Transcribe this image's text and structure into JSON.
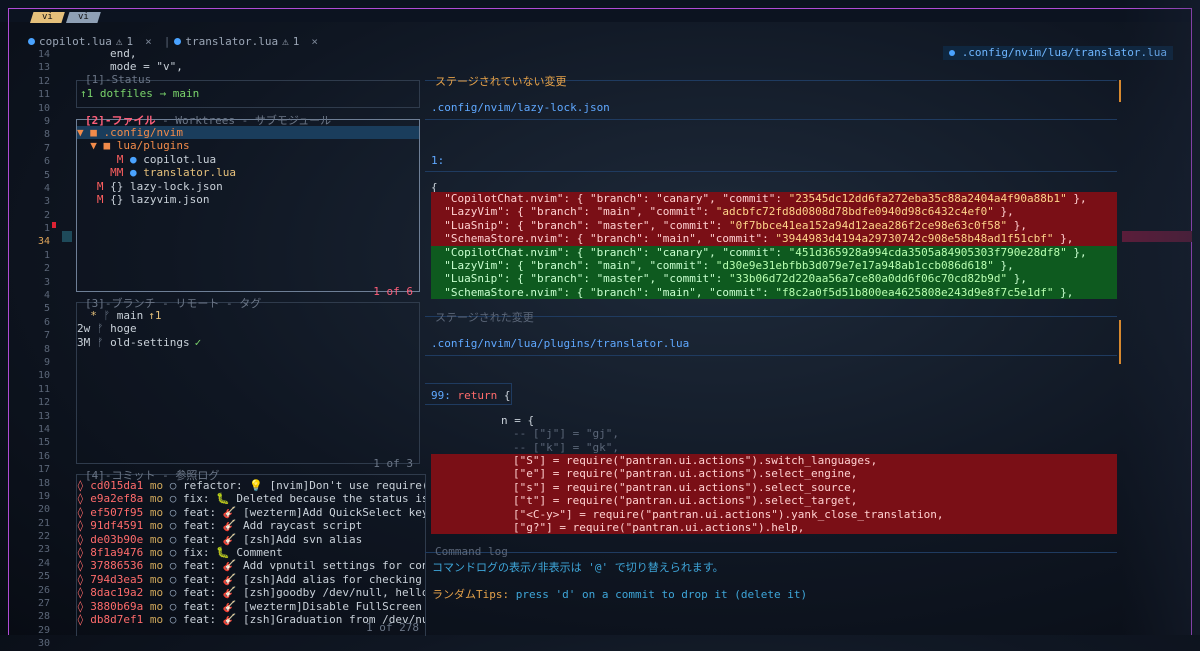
{
  "colors": {
    "accent": "#b04bd6",
    "active_title": "#ff5f7a",
    "path": "#5fa8ff",
    "orange": "#e5a24a",
    "deleted_bg": "#7a0f16",
    "added_bg": "#0e5a1f"
  },
  "mode_tabs": [
    "vi",
    "vi"
  ],
  "buffers": [
    {
      "name": "copilot.lua",
      "warn": "1",
      "close": "×"
    },
    {
      "name": "translator.lua",
      "warn": "1",
      "close": "×"
    }
  ],
  "path_badge": ".config/nvim/lua/translator.lua",
  "gutter": [
    "14",
    "13",
    "12",
    "11",
    "10",
    "9",
    "8",
    "7",
    "6",
    "5",
    "4",
    "3",
    "2",
    "1",
    "34",
    "1",
    "2",
    "3",
    "4",
    "5",
    "6",
    "7",
    "8",
    "9",
    "10",
    "11",
    "12",
    "13",
    "14",
    "15",
    "16",
    "17",
    "18",
    "19",
    "20",
    "21",
    "22",
    "23",
    "24",
    "25",
    "26",
    "27",
    "28",
    "29",
    "30"
  ],
  "code_top": [
    "end,",
    "mode = \"v\","
  ],
  "status": {
    "title": "[1]-Status",
    "text": "↑1 dotfiles → main"
  },
  "files": {
    "title_active": "[2]-ファイル",
    "title_rest": " - Worktrees - サブモジュール",
    "footer": "1 of 6",
    "items": [
      {
        "prefix": "▼ ",
        "name": ".config/nvim",
        "kind": "folder"
      },
      {
        "prefix": "  ▼ ",
        "name": "lua/plugins",
        "kind": "folder"
      },
      {
        "prefix": "      M ",
        "name": "copilot.lua",
        "kind": "lua"
      },
      {
        "prefix": "     MM ",
        "name": "translator.lua",
        "kind": "lua"
      },
      {
        "prefix": "   M ",
        "name": "lazy-lock.json",
        "kind": "json"
      },
      {
        "prefix": "   M ",
        "name": "lazyvim.json",
        "kind": "json"
      }
    ]
  },
  "branches": {
    "title": "[3]-ブランチ - リモート - タグ",
    "footer": "1 of 3",
    "items": [
      {
        "left": "  * ",
        "name": "main",
        "tag": "↑1"
      },
      {
        "left": "2w ",
        "name": "hoge",
        "tag": ""
      },
      {
        "left": "3M ",
        "name": "old-settings",
        "tag": "✓"
      }
    ]
  },
  "commits": {
    "title": "[4]-コミット - 参照ログ",
    "footer": "1 of 278",
    "items": [
      {
        "hash": "cd015da1",
        "author": "mo",
        "msg": "refactor: 💡 [nvim]Don't use require(\"foo"
      },
      {
        "hash": "e9a2ef8a",
        "author": "mo",
        "msg": "fix: 🐛 Deleted because the status is not"
      },
      {
        "hash": "ef507f95",
        "author": "mo",
        "msg": "feat: 🎸 [wezterm]Add QuickSelect keybind"
      },
      {
        "hash": "91df4591",
        "author": "mo",
        "msg": "feat: 🎸 Add raycast script"
      },
      {
        "hash": "de03b90e",
        "author": "mo",
        "msg": "feat: 🎸 [zsh]Add svn alias"
      },
      {
        "hash": "8f1a9476",
        "author": "mo",
        "msg": "fix: 🐛 Comment"
      },
      {
        "hash": "37886536",
        "author": "mo",
        "msg": "feat: 🎸 Add vpnutil settings for connect"
      },
      {
        "hash": "794d3ea5",
        "author": "mo",
        "msg": "feat: 🎸 [zsh]Add alias for checking my i"
      },
      {
        "hash": "8dac19a2",
        "author": "mo",
        "msg": "feat: 🎸 [zsh]goodby /dev/null, hello -qq"
      },
      {
        "hash": "3880b69a",
        "author": "mo",
        "msg": "feat: 🎸 [wezterm]Disable FullScreen comm"
      },
      {
        "hash": "db8d7ef1",
        "author": "mo",
        "msg": "feat: 🎸 [zsh]Graduation from /dev/null"
      }
    ]
  },
  "unstaged": {
    "title": "ステージされていない変更",
    "file": ".config/nvim/lazy-lock.json",
    "hunk": "1:",
    "brace": "{",
    "deleted": [
      {
        "k": "  \"CopilotChat.nvim\": { \"branch\": \"canary\", \"commit\": ",
        "v": "\"23545dc12dd6fa272eba35c88a2404a4f90a88b1\"",
        "t": " },"
      },
      {
        "k": "  \"LazyVim\": { \"branch\": \"main\", \"commit\": ",
        "v": "\"adcbfc72fd8d0808d78bdfe0940d98c6432c4ef0\"",
        "t": " },"
      },
      {
        "k": "  \"LuaSnip\": { \"branch\": \"master\", \"commit\": ",
        "v": "\"0f7bbce41ea152a94d12aea286f2ce98e63c0f58\"",
        "t": " },"
      },
      {
        "k": "  \"SchemaStore.nvim\": { \"branch\": \"main\", \"commit\": ",
        "v": "\"3944983d4194a29730742c908e58b48ad1f51cbf\"",
        "t": " },"
      }
    ],
    "added": [
      {
        "k": "  \"CopilotChat.nvim\": { \"branch\": \"canary\", \"commit\": ",
        "v": "\"451d365928a994cda3505a84905303f790e28df8\"",
        "t": " },"
      },
      {
        "k": "  \"LazyVim\": { \"branch\": \"main\", \"commit\": ",
        "v": "\"d30e9e31ebfbb3d079e7e17a948ab1ccb086d618\"",
        "t": " },"
      },
      {
        "k": "  \"LuaSnip\": { \"branch\": \"master\", \"commit\": ",
        "v": "\"33b06d72d220aa56a7ce80a0dd6f06c70cd82b9d\"",
        "t": " },"
      },
      {
        "k": "  \"SchemaStore.nvim\": { \"branch\": \"main\", \"commit\": ",
        "v": "\"f8c2a0f5d51b800ea4625808e243d9e8f7c5e1df\"",
        "t": " },"
      }
    ]
  },
  "staged": {
    "title": "ステージされた変更",
    "file": ".config/nvim/lua/plugins/translator.lua",
    "hunk_no": "99:",
    "hunk_kw": "return",
    "hunk_rest": " {",
    "context": [
      "n = {",
      "-- [\"j\"] = \"gj\",",
      "-- [\"k\"] = \"gk\","
    ],
    "deleted": [
      "[\"S\"] = require(\"pantran.ui.actions\").switch_languages,",
      "[\"e\"] = require(\"pantran.ui.actions\").select_engine,",
      "[\"s\"] = require(\"pantran.ui.actions\").select_source,",
      "[\"t\"] = require(\"pantran.ui.actions\").select_target,",
      "[\"<C-y>\"] = require(\"pantran.ui.actions\").yank_close_translation,",
      "[\"g?\"] = require(\"pantran.ui.actions\").help,"
    ]
  },
  "command_log": {
    "title": "Command log",
    "line1": "コマンドログの表示/非表示は '@' で切り替えられます。",
    "tip_label": "ランダムTips:",
    "tip_text": " press 'd' on a commit to drop it (delete it)"
  }
}
